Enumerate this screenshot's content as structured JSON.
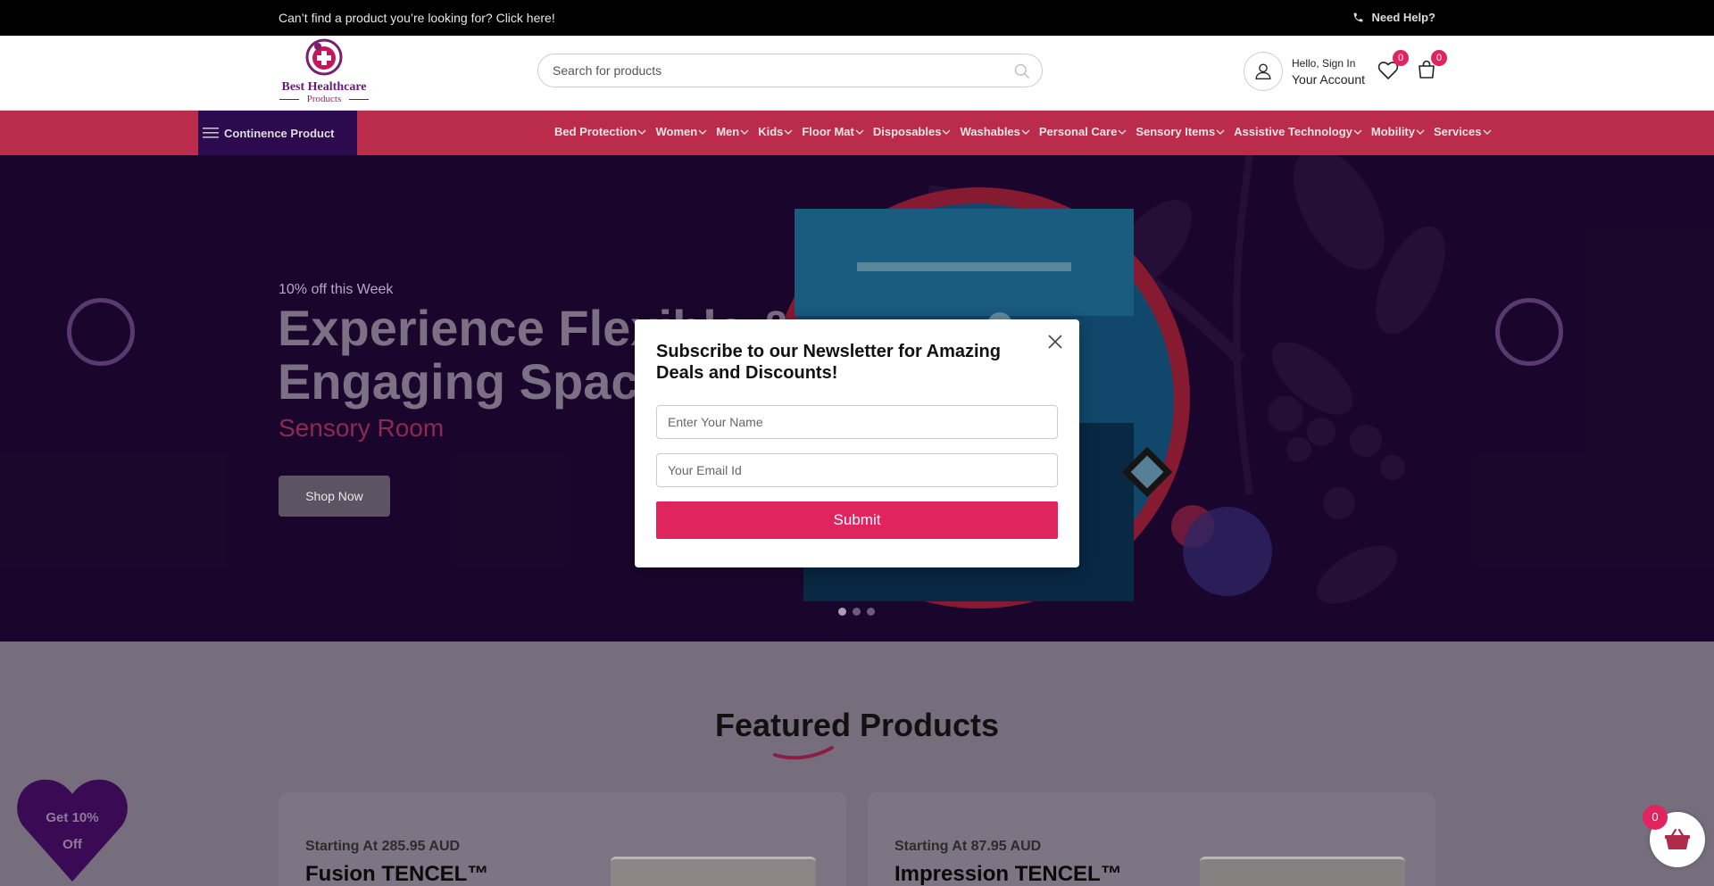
{
  "topbar": {
    "message": "Can’t find a product you’re looking for? Click here!",
    "help": "Need Help?"
  },
  "header": {
    "logo_line1": "Best Healthcare",
    "logo_line2": "Products",
    "search_placeholder": "Search for products",
    "greeting": "Hello, Sign In",
    "account": "Your Account",
    "wishlist_count": "0",
    "cart_count": "0"
  },
  "nav": {
    "category_button": "Continence Product",
    "items": [
      {
        "label": "Bed Protection"
      },
      {
        "label": "Women"
      },
      {
        "label": "Men"
      },
      {
        "label": "Kids"
      },
      {
        "label": "Floor Mat"
      },
      {
        "label": "Disposables"
      },
      {
        "label": "Washables"
      },
      {
        "label": "Personal Care"
      },
      {
        "label": "Sensory Items"
      },
      {
        "label": "Assistive Technology"
      },
      {
        "label": "Mobility"
      },
      {
        "label": "Services"
      }
    ]
  },
  "hero": {
    "pre": "10% off this Week",
    "headline_line1": "Experience Flexible &",
    "headline_line2": "Engaging Space",
    "subtitle": "Sensory Room",
    "button": "Shop Now",
    "slides": 3,
    "active_slide": 1
  },
  "featured": {
    "title": "Featured Products",
    "cards": [
      {
        "price": "Starting At 285.95 AUD",
        "name": "Fusion TENCEL™"
      },
      {
        "price": "Starting At 87.95 AUD",
        "name": "Impression TENCEL™"
      }
    ]
  },
  "promo": {
    "line1": "Get 10%",
    "line2": "Off"
  },
  "basket": {
    "count": "0"
  },
  "modal": {
    "title": "Subscribe to our Newsletter for Amazing Deals and Discounts!",
    "name_placeholder": "Enter Your Name",
    "email_placeholder": "Your Email Id",
    "submit": "Submit"
  },
  "colors": {
    "accent": "#e0245e",
    "nav": "#ba2b4c",
    "hero_bg": "#2a0a45",
    "category_button": "#2d0a4e"
  }
}
